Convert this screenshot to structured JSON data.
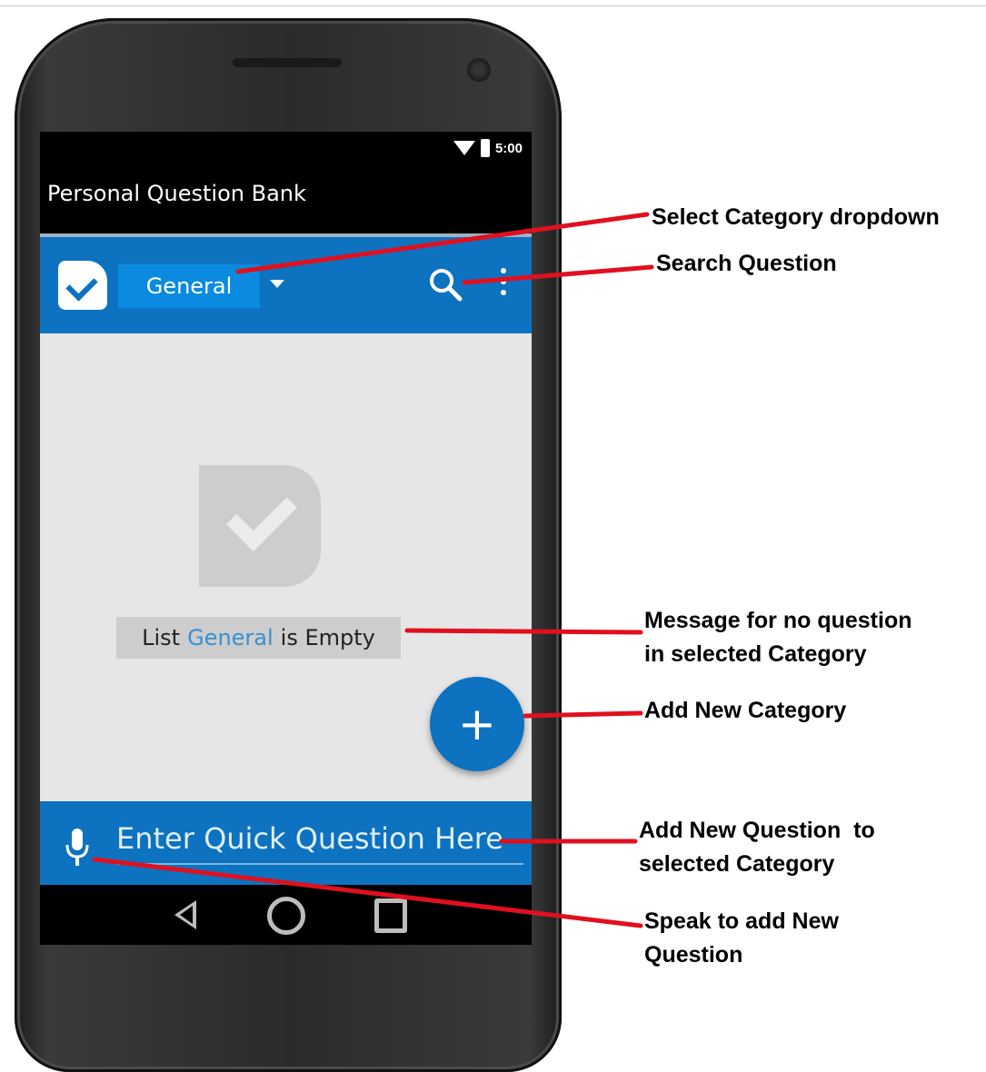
{
  "status_bar": {
    "time": "5:00"
  },
  "app": {
    "title": "Personal Question Bank",
    "selected_category": "General",
    "empty_message": {
      "prefix": "List",
      "category": "General",
      "suffix": "is Empty"
    },
    "fab_symbol": "+",
    "quick_input_placeholder": "Enter Quick Question Here"
  },
  "icons": {
    "logo": "checkbox-logo-icon",
    "dropdown": "caret-down-icon",
    "search": "search-icon",
    "overflow": "more-vert-icon",
    "empty_state": "checkbox-placeholder-icon",
    "mic": "mic-icon",
    "nav": [
      "back-icon",
      "home-icon",
      "recents-icon"
    ]
  },
  "colors": {
    "primary": "#0d72bf",
    "accent_text": "#3a8fd0",
    "annotation": "#e0101f"
  },
  "annotations": [
    {
      "id": "category",
      "lines": [
        "Select Category dropdown"
      ]
    },
    {
      "id": "search",
      "lines": [
        "Search Question"
      ]
    },
    {
      "id": "empty",
      "lines": [
        "Message for no question",
        "in selected Category"
      ]
    },
    {
      "id": "fab",
      "lines": [
        "Add New Category"
      ]
    },
    {
      "id": "input",
      "lines": [
        "Add New Question  to",
        "selected Category"
      ]
    },
    {
      "id": "mic",
      "lines": [
        "Speak to add New",
        "Question"
      ]
    }
  ]
}
